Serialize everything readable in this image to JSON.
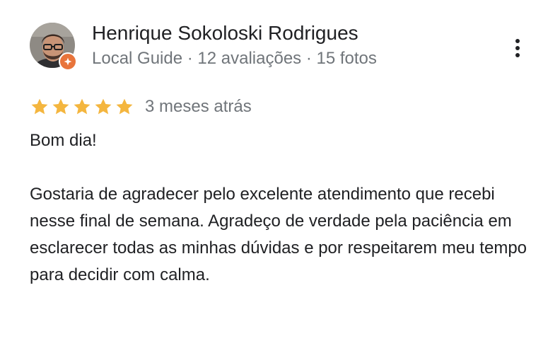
{
  "reviewer": {
    "name": "Henrique Sokoloski Rodrigues",
    "meta": "Local Guide · 12 avaliações · 15 fotos",
    "avatar_icon": "person-avatar",
    "badge_icon": "local-guide-badge-icon",
    "badge_color": "#e8743b"
  },
  "actions": {
    "more_icon": "more-vert-icon"
  },
  "review": {
    "rating": 5,
    "rating_max": 5,
    "star_color": "#f4b63f",
    "date": "3 meses atrás",
    "greeting": "Bom dia!",
    "body": "Gostaria de agradecer pelo excelente atendimento que recebi nesse final de semana. Agradeço de verdade pela paciência em esclarecer todas as minhas dúvidas e por respeitarem meu tempo para decidir com calma."
  }
}
